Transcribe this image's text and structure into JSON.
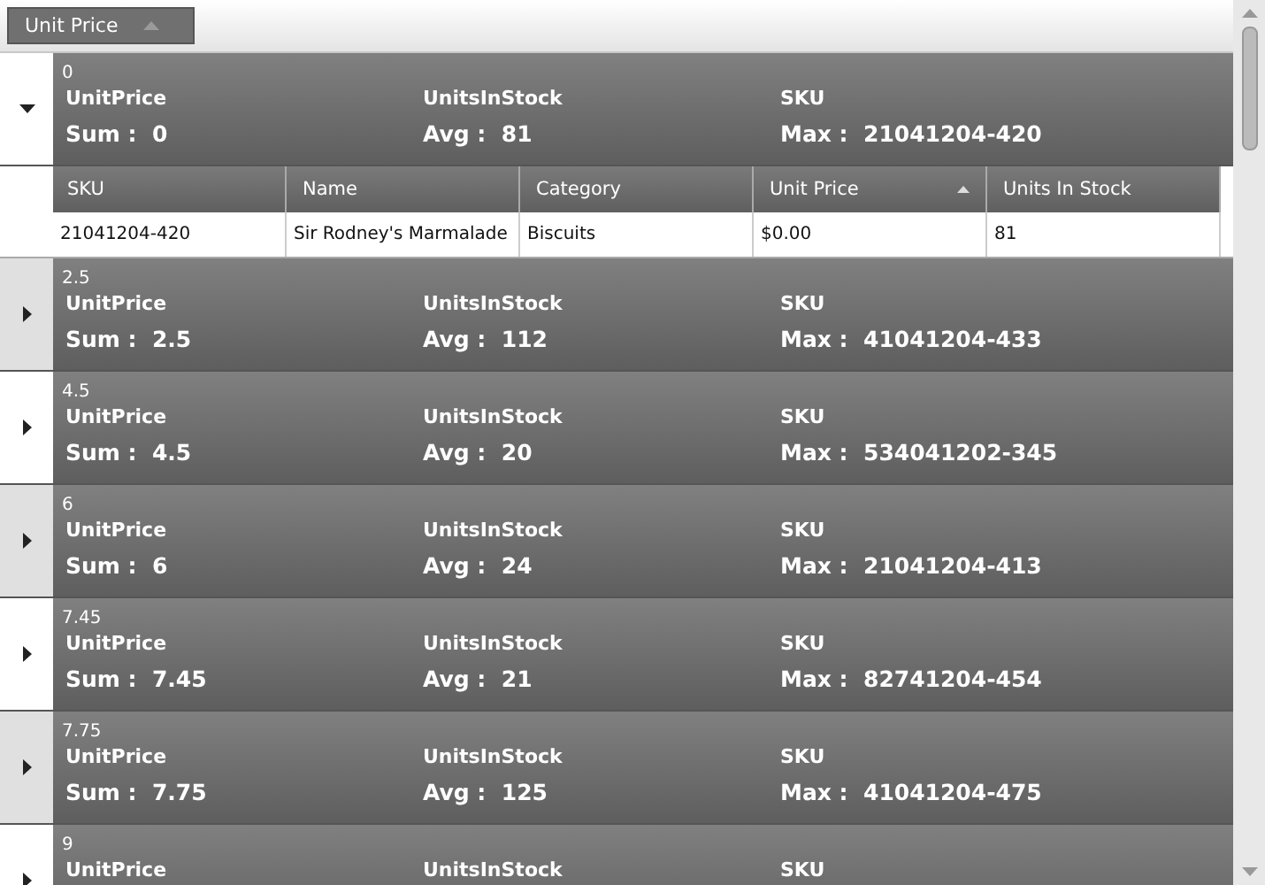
{
  "group_panel": {
    "chips": [
      {
        "label": "Unit Price",
        "sorted": true
      }
    ]
  },
  "groups": [
    {
      "key": "0",
      "expanded": true,
      "aggregates": [
        {
          "field": "UnitPrice",
          "func": "Sum :",
          "value": "0"
        },
        {
          "field": "UnitsInStock",
          "func": "Avg :",
          "value": "81"
        },
        {
          "field": "SKU",
          "func": "Max :",
          "value": "21041204-420"
        }
      ],
      "table": {
        "columns": [
          {
            "label": "SKU",
            "sorted": false
          },
          {
            "label": "Name",
            "sorted": false
          },
          {
            "label": "Category",
            "sorted": false
          },
          {
            "label": "Unit Price",
            "sorted": true
          },
          {
            "label": "Units In Stock",
            "sorted": false
          }
        ],
        "rows": [
          [
            "21041204-420",
            "Sir Rodney's Marmalade",
            "Biscuits",
            "$0.00",
            "81"
          ]
        ]
      }
    },
    {
      "key": "2.5",
      "expanded": false,
      "aggregates": [
        {
          "field": "UnitPrice",
          "func": "Sum :",
          "value": "2.5"
        },
        {
          "field": "UnitsInStock",
          "func": "Avg :",
          "value": "112"
        },
        {
          "field": "SKU",
          "func": "Max :",
          "value": "41041204-433"
        }
      ]
    },
    {
      "key": "4.5",
      "expanded": false,
      "aggregates": [
        {
          "field": "UnitPrice",
          "func": "Sum :",
          "value": "4.5"
        },
        {
          "field": "UnitsInStock",
          "func": "Avg :",
          "value": "20"
        },
        {
          "field": "SKU",
          "func": "Max :",
          "value": "534041202-345"
        }
      ]
    },
    {
      "key": "6",
      "expanded": false,
      "aggregates": [
        {
          "field": "UnitPrice",
          "func": "Sum :",
          "value": "6"
        },
        {
          "field": "UnitsInStock",
          "func": "Avg :",
          "value": "24"
        },
        {
          "field": "SKU",
          "func": "Max :",
          "value": "21041204-413"
        }
      ]
    },
    {
      "key": "7.45",
      "expanded": false,
      "aggregates": [
        {
          "field": "UnitPrice",
          "func": "Sum :",
          "value": "7.45"
        },
        {
          "field": "UnitsInStock",
          "func": "Avg :",
          "value": "21"
        },
        {
          "field": "SKU",
          "func": "Max :",
          "value": "82741204-454"
        }
      ]
    },
    {
      "key": "7.75",
      "expanded": false,
      "aggregates": [
        {
          "field": "UnitPrice",
          "func": "Sum :",
          "value": "7.75"
        },
        {
          "field": "UnitsInStock",
          "func": "Avg :",
          "value": "125"
        },
        {
          "field": "SKU",
          "func": "Max :",
          "value": "41041204-475"
        }
      ]
    },
    {
      "key": "9",
      "expanded": false,
      "aggregates": [
        {
          "field": "UnitPrice"
        },
        {
          "field": "UnitsInStock"
        },
        {
          "field": "SKU"
        }
      ]
    }
  ]
}
